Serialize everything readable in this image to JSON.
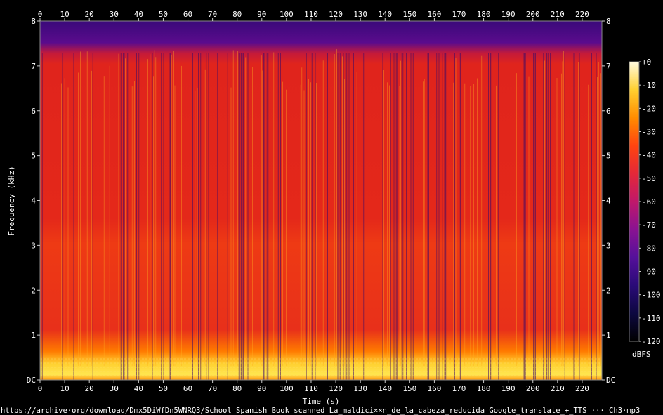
{
  "chart_data": {
    "type": "heatmap",
    "title": "",
    "xlabel": "Time (s)",
    "ylabel": "Frequency (kHz)",
    "xlim": [
      0,
      228
    ],
    "ylim": [
      0,
      8
    ],
    "x_ticks": [
      "0",
      "10",
      "20",
      "30",
      "40",
      "50",
      "60",
      "70",
      "80",
      "90",
      "100",
      "110",
      "120",
      "130",
      "140",
      "150",
      "160",
      "170",
      "180",
      "190",
      "200",
      "210",
      "220"
    ],
    "y_ticks": [
      "DC",
      "1",
      "2",
      "3",
      "4",
      "5",
      "6",
      "7",
      "8"
    ],
    "colorbar": {
      "label": "dBFS",
      "range": [
        -120,
        0
      ],
      "ticks": [
        "+0",
        "-10",
        "-20",
        "-30",
        "-40",
        "-50",
        "-60",
        "-70",
        "-80",
        "-90",
        "-100",
        "-110",
        "-120"
      ],
      "colors": [
        "#000000",
        "#1a0b5c",
        "#3e0a8a",
        "#7a0b9a",
        "#b0127a",
        "#e0203c",
        "#ff3010",
        "#ff6a00",
        "#ffb000",
        "#ffe640",
        "#fffbd0"
      ]
    },
    "bands": [
      {
        "from_khz": 7.35,
        "to_khz": 8.0,
        "level_dbfs": -85
      },
      {
        "from_khz": 3.0,
        "to_khz": 7.35,
        "level_dbfs": -50
      },
      {
        "from_khz": 0.55,
        "to_khz": 3.0,
        "level_dbfs": -45
      },
      {
        "from_khz": 0.0,
        "to_khz": 0.55,
        "level_dbfs": -18
      }
    ]
  },
  "footer": {
    "source": "https://archive·org/download/Dmx5DiWfDn5WNRQ3/School Spanish Book scanned La_maldici××n_de_la_cabeza_reducida Google_translate_+_TTS ··· Ch3·mp3"
  }
}
